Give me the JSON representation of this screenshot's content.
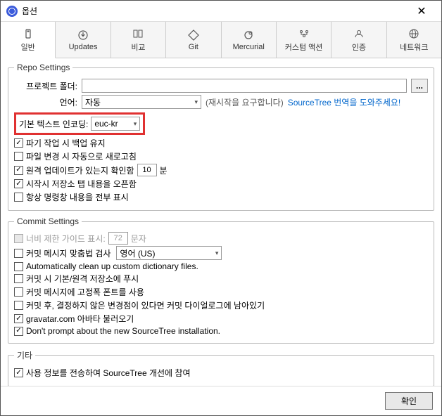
{
  "window": {
    "title": "옵션"
  },
  "tabs": [
    {
      "label": "일반"
    },
    {
      "label": "Updates"
    },
    {
      "label": "비교"
    },
    {
      "label": "Git"
    },
    {
      "label": "Mercurial"
    },
    {
      "label": "커스텀 액션"
    },
    {
      "label": "인증"
    },
    {
      "label": "네트워크"
    }
  ],
  "repo": {
    "legend": "Repo Settings",
    "projectFolderLabel": "프로젝트 폴더:",
    "projectFolderValue": "",
    "browseLabel": "...",
    "langLabel": "언어:",
    "langValue": "자동",
    "restartNote": "(재시작을 요구합니다)",
    "helpLink": "SourceTree 번역을 도와주세요!",
    "encodingLabel": "기본 텍스트 인코딩:",
    "encodingValue": "euc-kr",
    "checks": {
      "c1": {
        "label": "파기 작업 시 백업 유지",
        "checked": true
      },
      "c2": {
        "label": "파일 변경 시 자동으로 새로고침",
        "checked": false
      },
      "c3": {
        "label": "원격 업데이트가 있는지 확인함",
        "checked": true,
        "numValue": "10",
        "suffix": "분"
      },
      "c4": {
        "label": "시작시 저장소 탭 내용을 오픈함",
        "checked": true
      },
      "c5": {
        "label": "항상 명령창 내용을 전부 표시",
        "checked": false
      }
    }
  },
  "commit": {
    "legend": "Commit Settings",
    "widthLabel": "너비 제한 가이드 표시:",
    "widthValue": "72",
    "widthSuffix": "문자",
    "spellLabel": "커밋 메시지 맞춤법 검사",
    "spellLang": "영어 (US)",
    "checks": {
      "d1": {
        "label": "Automatically clean up custom dictionary files.",
        "checked": false
      },
      "d2": {
        "label": "커밋 시 기본/원격 저장소에 푸시",
        "checked": false
      },
      "d3": {
        "label": "커밋 메시지에 고정폭 폰트를 사용",
        "checked": false
      },
      "d4": {
        "label": "커밋 후, 결정하지 않은 변경점이 있다면 커밋 다이얼로그에 남아있기",
        "checked": false
      },
      "d5": {
        "label": "gravatar.com 아바타 불러오기",
        "checked": true
      },
      "d6": {
        "label": "Don't prompt about the new SourceTree installation.",
        "checked": true
      }
    }
  },
  "other": {
    "legend": "기타",
    "c1": {
      "label": "사용 정보를 전송하여 SourceTree 개선에 참여",
      "checked": true
    }
  },
  "footer": {
    "ok": "확인"
  }
}
